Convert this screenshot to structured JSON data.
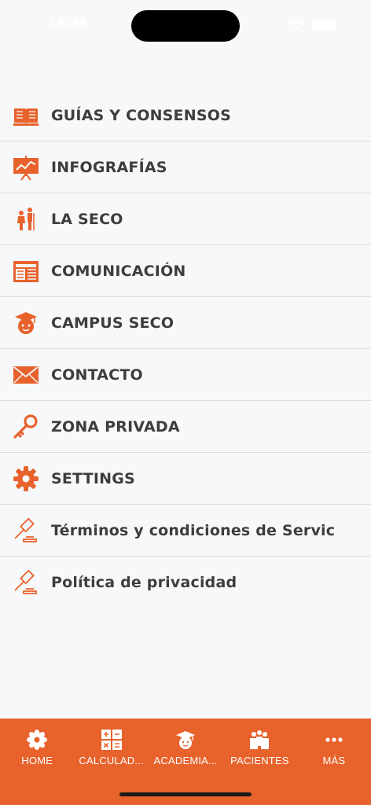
{
  "status_bar": {
    "time": "16:48"
  },
  "colors": {
    "accent": "#e8622c",
    "text": "#3d3d3d",
    "background": "#f7f8fa"
  },
  "menu": {
    "items": [
      {
        "label": "GUÍAS Y CONSENSOS",
        "icon": "book-icon"
      },
      {
        "label": "INFOGRAFÍAS",
        "icon": "presentation-chart-icon"
      },
      {
        "label": "LA SECO",
        "icon": "people-icon"
      },
      {
        "label": "COMUNICACIÓN",
        "icon": "newspaper-icon"
      },
      {
        "label": "CAMPUS SECO",
        "icon": "graduate-icon"
      },
      {
        "label": "CONTACTO",
        "icon": "envelope-icon"
      },
      {
        "label": "ZONA PRIVADA",
        "icon": "key-icon"
      },
      {
        "label": "SETTINGS",
        "icon": "gear-icon"
      },
      {
        "label": "Términos y condiciones de Servic",
        "icon": "gavel-icon"
      },
      {
        "label": "Política de privacidad",
        "icon": "gavel-icon"
      }
    ]
  },
  "tab_bar": {
    "tabs": [
      {
        "label": "HOME",
        "icon": "flower-icon"
      },
      {
        "label": "CALCULAD...",
        "icon": "calculator-icon"
      },
      {
        "label": "ACADEMIA...",
        "icon": "graduate-icon"
      },
      {
        "label": "PACIENTES",
        "icon": "patients-icon"
      },
      {
        "label": "MÁS",
        "icon": "more-dots-icon"
      }
    ]
  }
}
